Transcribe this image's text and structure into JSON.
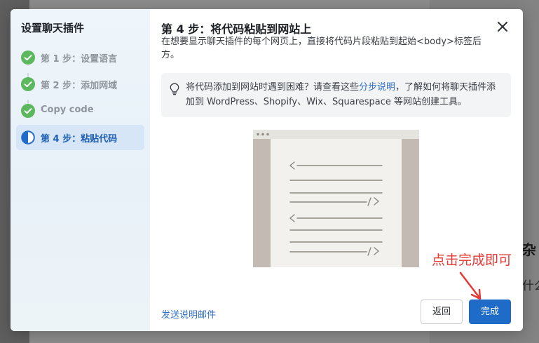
{
  "sidebar": {
    "title": "设置聊天插件",
    "steps": [
      {
        "label": "第 1 步：设置语言",
        "state": "done"
      },
      {
        "label": "第 2 步：添加网域",
        "state": "done"
      },
      {
        "label": "Copy code",
        "state": "done"
      },
      {
        "label": "第 4 步：粘贴代码",
        "state": "current"
      }
    ]
  },
  "header": {
    "title": "第 4 步：将代码粘贴到网站上",
    "description": "在想要显示聊天插件的每个网页上，直接将代码片段粘贴到起始<body>标签后方。"
  },
  "tip": {
    "text_before": "将代码添加到网站时遇到困难？请查看这些",
    "link": "分步说明",
    "text_after": "，了解如何将聊天插件添加到 WordPress、Shopify、Wix、Squarespace 等网站创建工具。"
  },
  "footer": {
    "email_link": "发送说明邮件",
    "back_label": "返回",
    "done_label": "完成"
  },
  "annotation": {
    "text": "点击完成即可"
  },
  "background": {
    "fragment1": "杂",
    "fragment2": "什么"
  },
  "colors": {
    "accent": "#1f6cc8",
    "link": "#2f6fc7",
    "done_check": "#5cb85c",
    "annotation": "#e53935"
  }
}
